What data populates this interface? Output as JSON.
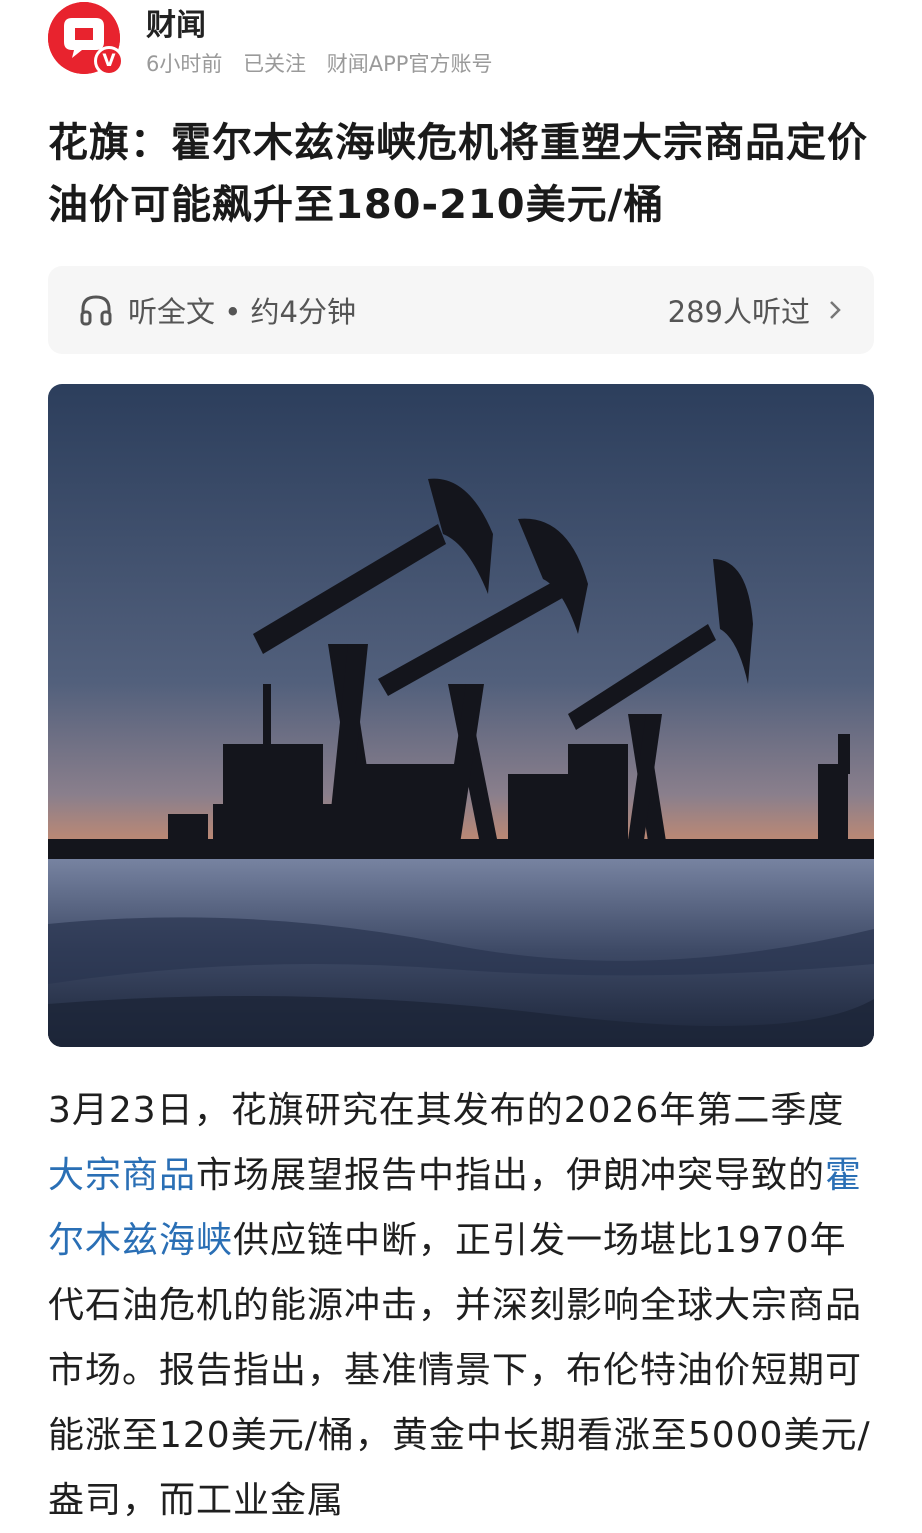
{
  "author": {
    "name": "财闻",
    "badge": "V",
    "time_ago": "6小时前",
    "follow_status": "已关注",
    "account_desc": "财闻APP官方账号"
  },
  "article": {
    "title": "花旗：霍尔木兹海峡危机将重塑大宗商品定价 油价可能飙升至180-210美元/桶"
  },
  "listen": {
    "label": "听全文 • 约4分钟",
    "listeners": "289人听过"
  },
  "hero_image": {
    "icon": "oil-pump-jacks-image"
  },
  "body": {
    "p1_a": "3月23日，花旗研究在其发布的2026年第二季度",
    "p1_link1": "大宗商品",
    "p1_b": "市场展望报告中指出，伊朗冲突导致的",
    "p1_link2": "霍尔木兹海峡",
    "p1_c": "供应链中断，正引发一场堪比1970年代石油危机的能源冲击，并深刻影响全球大宗商品市场。报告指出，基准情景下，布伦特油价短期可能涨至120美元/桶，黄金中长期看涨至5000美元/盎司，而工业金属"
  },
  "colors": {
    "brand_red": "#e8232e",
    "link_blue": "#2a6fb5"
  }
}
